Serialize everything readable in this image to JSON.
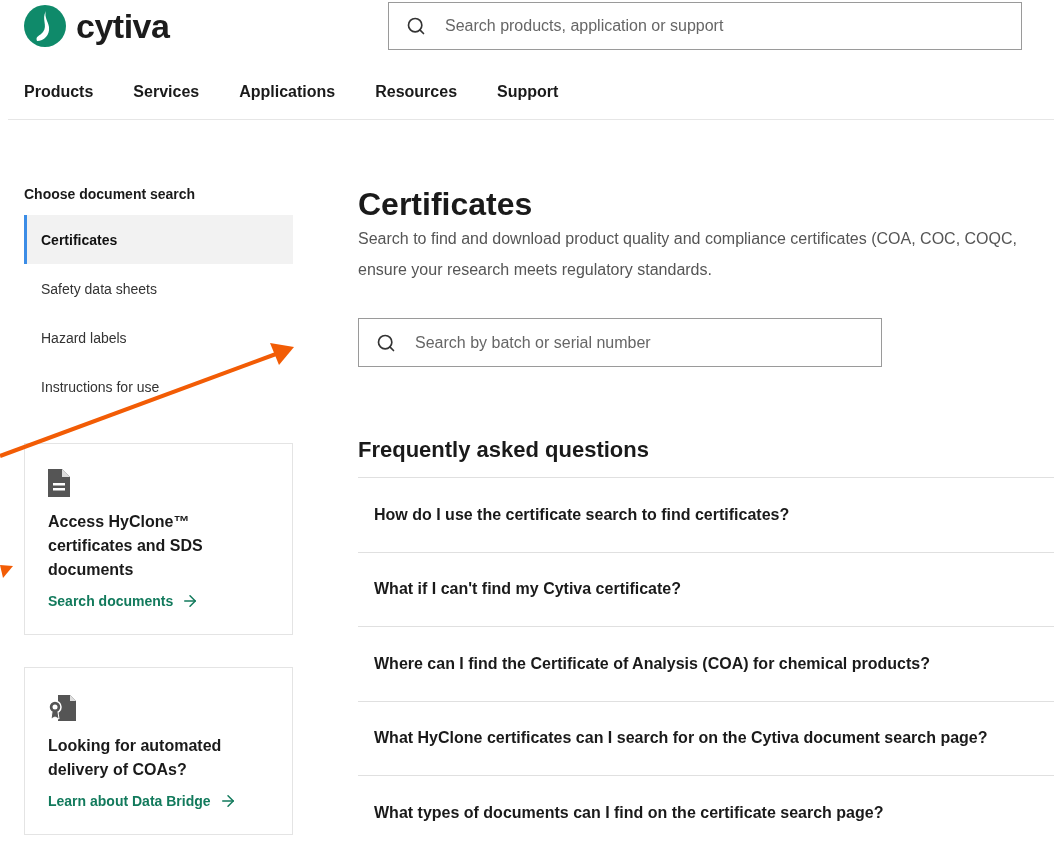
{
  "header": {
    "logo_text": "cytiva",
    "search": {
      "placeholder": "Search products, application or support"
    }
  },
  "nav": [
    "Products",
    "Services",
    "Applications",
    "Resources",
    "Support"
  ],
  "sidebar": {
    "heading": "Choose document search",
    "items": [
      {
        "label": "Certificates",
        "selected": true
      },
      {
        "label": "Safety data sheets",
        "selected": false
      },
      {
        "label": "Hazard labels",
        "selected": false
      },
      {
        "label": "Instructions for use",
        "selected": false
      }
    ],
    "cards": [
      {
        "kind": "document",
        "title": "Access HyClone™ certificates and SDS documents",
        "link": "Search documents"
      },
      {
        "kind": "certificate",
        "title": "Looking for automated delivery of COAs?",
        "link": "Learn about Data Bridge"
      }
    ]
  },
  "main": {
    "title": "Certificates",
    "description_lines": [
      "Search to find and download product quality and compliance certificates (COA, COC, COQC,",
      "ensure your research meets regulatory standards."
    ],
    "search": {
      "placeholder": "Search by batch or serial number"
    },
    "faq_heading": "Frequently asked questions",
    "faq": [
      "How do I use the certificate search to find certificates?",
      "What if I can't find my Cytiva certificate?",
      "Where can I find the Certificate of Analysis (COA) for chemical products?",
      "What HyClone certificates can I search for on the Cytiva document search page?",
      "What types of documents can I find on the certificate search page?"
    ]
  }
}
